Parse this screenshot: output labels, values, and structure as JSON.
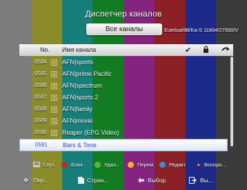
{
  "background_colors": [
    "#7c7c7c",
    "#8c8b2a",
    "#177f79",
    "#137c22",
    "#84247f",
    "#8b2025",
    "#1e2a8a",
    "#3a3a3a"
  ],
  "title": "Диспетчер каналов",
  "filter_label": "Все каналы",
  "satellite": "Eutelsat9B/Ka-S 11804/27500/V",
  "header": {
    "no": "No.",
    "name": "Имя канала"
  },
  "channels": [
    {
      "no": "0584",
      "name": "AFN|sports"
    },
    {
      "no": "0585",
      "name": "AFN|prime Pacific"
    },
    {
      "no": "0586",
      "name": "AFN|spectrum"
    },
    {
      "no": "0587",
      "name": "AFN|sports 2"
    },
    {
      "no": "0588",
      "name": "AFN|family"
    },
    {
      "no": "0589",
      "name": "AFN|movie"
    },
    {
      "no": "0590",
      "name": "Reaper (EPG Video)"
    },
    {
      "no": "0591",
      "name": "Bars & Tone"
    }
  ],
  "hints": {
    "skip": "Слут..",
    "lock": "Блок",
    "delete": "Удал..",
    "move": "Перем",
    "edit": "Редакт",
    "play": "Воспро..."
  },
  "nav": {
    "move": "Пер...",
    "page": "Стран...",
    "select": "Выбор",
    "exit": "Вы..."
  },
  "accent": {
    "red": "#c0282a",
    "green": "#58b52e",
    "yellow": "#f3b21c",
    "blue": "#3b8be6"
  }
}
